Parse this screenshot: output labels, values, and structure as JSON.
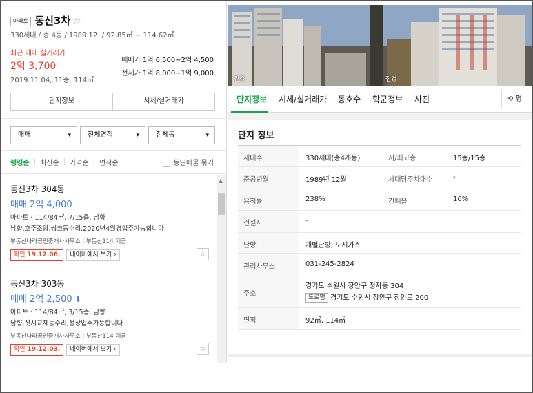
{
  "listing": {
    "badge": "아파트",
    "name": "동신3차",
    "fav_icon": "☆",
    "meta": "330세대 / 총 4동 / 1989.12. / 92.85㎡ ~ 114.62㎡",
    "recent_label": "최근 매매 실거래가",
    "recent_price": "2억 3,700",
    "recent_date": "2019.11.04, 11층, 114㎡",
    "sale_label": "매매가",
    "sale_value": "1억 6,500~2억 4,500",
    "lease_label": "전세가",
    "lease_value": "1억 8,000~1억 9,000"
  },
  "tab_buttons": [
    "단지정보",
    "시세/실거래가"
  ],
  "filters": [
    {
      "label": "매매"
    },
    {
      "label": "전체면적"
    },
    {
      "label": "전체동"
    }
  ],
  "sorts": {
    "items": [
      "랭킹순",
      "최신순",
      "가격순",
      "면적순"
    ],
    "same_listing_label": "동일매물 묶기"
  },
  "items": [
    {
      "name": "동신3차 304동",
      "price": "매매 2억 4,000",
      "arrow": "",
      "detail1": "아파트 · 114/84㎡, 7/15층, 남향",
      "detail2": "남향,호주조망,씽크등수리.2020년4월경입주가능합니다.",
      "agency": "부동산나라공인중개사사무소 | 부동산114 제공",
      "confirm_label": "확인",
      "confirm_date": "19.12.06.",
      "naver_label": "네이버에서 보기 ›"
    },
    {
      "name": "동신3차 303동",
      "price": "매매 2억 2,500",
      "arrow": "⬇",
      "detail1": "아파트 · 114/84㎡, 3/15층, 남향",
      "detail2": "남향,샷시교체등수리,정상입주가능합니다.",
      "agency": "부동산나라공인중개사사무소 | 부동산114 제공",
      "confirm_label": "확인",
      "confirm_date": "19.12.03.",
      "naver_label": "네이버에서 보기 ›"
    }
  ],
  "photo_labels": [
    "전경",
    "전경"
  ],
  "right_tabs": [
    "단지정보",
    "시세/실거래가",
    "동호수",
    "학군정보",
    "사진"
  ],
  "refresh_label": "평",
  "info_title": "단지 정보",
  "info_rows": [
    {
      "k1": "세대수",
      "v1": "330세대(총4개동)",
      "k2": "저/최고층",
      "v2": "15층/15층"
    },
    {
      "k1": "준공년월",
      "v1": "1989년 12월",
      "k2": "세대당주차대수",
      "v2": "-"
    },
    {
      "k1": "용적률",
      "v1": "238%",
      "k2": "건폐율",
      "v2": "16%"
    },
    {
      "k1": "건설사",
      "v1": "-"
    },
    {
      "k1": "난방",
      "v1": "개별난방, 도시가스"
    },
    {
      "k1": "관리사무소",
      "v1": "031-245-2824"
    },
    {
      "k1": "주소",
      "v1": "경기도 수원시 장안구 정자동 304",
      "road_badge": "도로명",
      "v1b": "경기도 수원시 장안구 장안로 200"
    },
    {
      "k1": "면적",
      "v1": "92㎡, 114㎡"
    }
  ]
}
